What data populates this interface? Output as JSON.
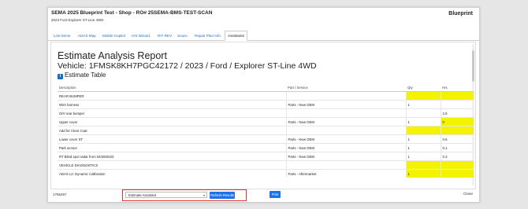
{
  "header": {
    "title": "SEMA 2025 Blueprint Test - Shop - RO# 25SEMA-BMS-TEST-SCAN",
    "subtitle": "2023 Ford Explorer ST-Line 4WD",
    "brand": "Blueprint"
  },
  "tabs": [
    {
      "label": "Line Items"
    },
    {
      "label": "ADAS Map"
    },
    {
      "label": "Mobile Copilot"
    },
    {
      "label": "IVS Wizard"
    },
    {
      "label": "RIT REV"
    },
    {
      "label": "Scanv"
    },
    {
      "label": "Repair Plan Info"
    },
    {
      "label": "Assistants"
    }
  ],
  "report": {
    "title": "Estimate Analysis Report",
    "vehicle": "Vehicle: 1FMSK8KH7PGC42172 / 2023 / Ford / Explorer ST-Line 4WD",
    "table_title": "Estimate Table",
    "columns": {
      "description": "Description",
      "part": "Part / Service",
      "qty": "Qty",
      "hrs": "Hrs"
    },
    "rows": [
      {
        "description": "REAR BUMPER",
        "part": "",
        "qty": "",
        "hrs": "",
        "highlight": true
      },
      {
        "description": "Wire harness",
        "part": "Parts - New OEM",
        "qty": "1",
        "hrs": ""
      },
      {
        "description": "O/H rear bumper",
        "part": "",
        "qty": "",
        "hrs": "2.5"
      },
      {
        "description": "Upper cover",
        "part": "Parts - New OEM",
        "qty": "1",
        "hrs": "0",
        "hrs_highlight": true
      },
      {
        "description": "Add for Clear Coat",
        "part": "",
        "qty": "",
        "hrs": "",
        "highlight": true
      },
      {
        "description": "Lower cover ST",
        "part": "Parts - New OEM",
        "qty": "1",
        "hrs": "0.6"
      },
      {
        "description": "Park sensor",
        "part": "Parts - New OEM",
        "qty": "1",
        "hrs": "0.1"
      },
      {
        "description": "RT Blind spot radar from 04/28/2023",
        "part": "Parts - New OEM",
        "qty": "1",
        "hrs": "0.3"
      },
      {
        "description": "VEHICLE DIAGNOSTICS",
        "part": "",
        "qty": "",
        "hrs": "",
        "highlight": true
      },
      {
        "description": "ADAS L2: Dynamic Calibration",
        "part": "Parts - Aftermarket",
        "qty": "1",
        "hrs": "",
        "highlight": true
      }
    ]
  },
  "footer": {
    "version": "1766457",
    "select_value": "Estimate Assistant",
    "refresh_label": "Refresh Results",
    "print_label": "Print",
    "close_label": "Close"
  },
  "colors": {
    "accent": "#1a73e8",
    "highlight": "#f3f300",
    "picker_border": "#e0322f"
  }
}
